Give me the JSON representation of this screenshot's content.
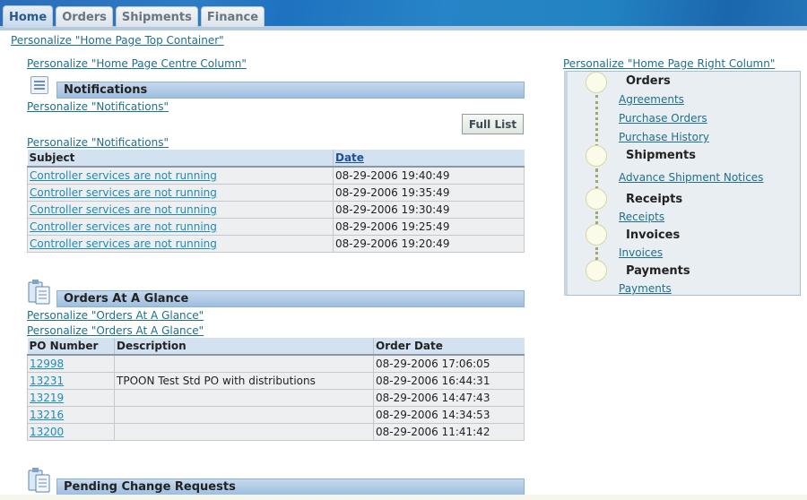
{
  "tabs": [
    {
      "label": "Home",
      "active": true
    },
    {
      "label": "Orders",
      "active": false
    },
    {
      "label": "Shipments",
      "active": false
    },
    {
      "label": "Finance",
      "active": false
    }
  ],
  "personalize": {
    "top_container": "Personalize \"Home Page Top Container\"",
    "centre_column": "Personalize \"Home Page Centre Column\"",
    "right_column": "Personalize \"Home Page Right Column\"",
    "notifications_1": "Personalize \"Notifications\"",
    "notifications_2": "Personalize \"Notifications\"",
    "orders_1": "Personalize \"Orders At A Glance\"",
    "orders_2": "Personalize \"Orders At A Glance\""
  },
  "notifications": {
    "title": "Notifications",
    "full_list_button": "Full List",
    "columns": [
      "Subject",
      "Date"
    ],
    "rows": [
      {
        "subject": "Controller services are not running",
        "date": "08-29-2006 19:40:49"
      },
      {
        "subject": "Controller services are not running",
        "date": "08-29-2006 19:35:49"
      },
      {
        "subject": "Controller services are not running",
        "date": "08-29-2006 19:30:49"
      },
      {
        "subject": "Controller services are not running",
        "date": "08-29-2006 19:25:49"
      },
      {
        "subject": "Controller services are not running",
        "date": "08-29-2006 19:20:49"
      }
    ]
  },
  "orders": {
    "title": "Orders At A Glance",
    "columns": [
      "PO Number",
      "Description",
      "Order Date"
    ],
    "rows": [
      {
        "po": "12998",
        "description": "",
        "date": "08-29-2006 17:06:05"
      },
      {
        "po": "13231",
        "description": "TPOON Test Std PO with distributions",
        "date": "08-29-2006 16:44:31"
      },
      {
        "po": "13219",
        "description": "",
        "date": "08-29-2006 14:47:43"
      },
      {
        "po": "13216",
        "description": "",
        "date": "08-29-2006 14:34:53"
      },
      {
        "po": "13200",
        "description": "",
        "date": "08-29-2006 11:41:42"
      }
    ]
  },
  "pending": {
    "title": "Pending Change Requests"
  },
  "process": {
    "stages": [
      {
        "title": "Orders",
        "links": [
          "Agreements",
          "Purchase Orders",
          "Purchase History"
        ]
      },
      {
        "title": "Shipments",
        "links": [
          "Advance Shipment Notices"
        ]
      },
      {
        "title": "Receipts",
        "links": [
          "Receipts"
        ]
      },
      {
        "title": "Invoices",
        "links": [
          "Invoices"
        ]
      },
      {
        "title": "Payments",
        "links": [
          "Payments"
        ]
      }
    ]
  }
}
